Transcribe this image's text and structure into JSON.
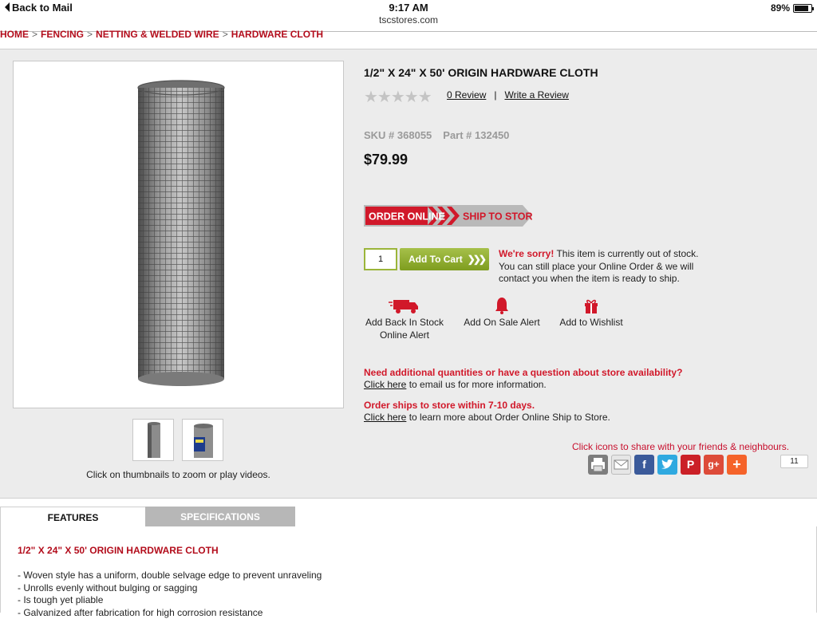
{
  "status_bar": {
    "back_label": "Back to Mail",
    "time": "9:17 AM",
    "battery_percent": "89%",
    "battery_level": 0.89
  },
  "browser": {
    "url": "tscstores.com"
  },
  "breadcrumb": [
    "HOME",
    "FENCING",
    "NETTING & WELDED WIRE",
    "HARDWARE CLOTH"
  ],
  "breadcrumb_separator": ">",
  "product": {
    "title": "1/2\" X 24\" X 50' ORIGIN HARDWARE CLOTH",
    "rating_stars": "★★★★★",
    "rating_value": 0,
    "review_count_label": "0 Review",
    "write_review_label": "Write a Review",
    "review_separator": "|",
    "sku_label": "SKU # 368055",
    "part_label": "Part # 132450",
    "price": "$79.99",
    "badge_left": "ORDER ONLINE",
    "badge_right": "SHIP TO STORE",
    "quantity": "1",
    "add_to_cart_label": "Add To Cart",
    "add_to_cart_arrows": "❯❯❯",
    "stock_sorry": "We're sorry!",
    "stock_message": " This item is currently out of stock. You can still place your Online Order & we will contact you when the item is ready to ship."
  },
  "alerts": [
    {
      "label_line1": "Add Back In Stock",
      "label_line2": "Online Alert",
      "icon": "truck-icon"
    },
    {
      "label_line1": "Add On Sale Alert",
      "label_line2": "",
      "icon": "bell-icon"
    },
    {
      "label_line1": "Add to Wishlist",
      "label_line2": "",
      "icon": "gift-icon"
    }
  ],
  "info": {
    "quantities_heading": "Need additional quantities or have a question about store availability?",
    "quantities_link": "Click here",
    "quantities_text": " to email us for more information.",
    "ship_heading": "Order ships to store within 7-10 days.",
    "ship_link": "Click here",
    "ship_text": " to learn more about Order Online Ship to Store."
  },
  "gallery": {
    "thumb_note": "Click on thumbnails to zoom or play videos."
  },
  "share": {
    "note": "Click icons to share with your friends & neighbours.",
    "count": "11",
    "icons": [
      "print-icon",
      "email-icon",
      "facebook-icon",
      "twitter-icon",
      "pinterest-icon",
      "google-plus-icon",
      "addthis-plus-icon"
    ],
    "colors": {
      "print": "#7d7d7d",
      "email": "#e6e6e6",
      "facebook": "#3b5a9a",
      "twitter": "#2fa9e0",
      "pinterest": "#cb2027",
      "google_plus": "#dd4b39",
      "addthis": "#f5632a"
    }
  },
  "tabs": {
    "features": "FEATURES",
    "specifications": "SPECIFICATIONS"
  },
  "features": {
    "title": "1/2\" X 24\" X 50' ORIGIN HARDWARE CLOTH",
    "bullets": [
      "- Woven style has a uniform, double selvage edge to prevent unraveling",
      "- Unrolls evenly without bulging or sagging",
      "- Is tough yet pliable",
      "- Galvanized after fabrication for high corrosion resistance"
    ]
  },
  "colors": {
    "brand_red": "#b30d1c",
    "alert_red": "#d1182a",
    "cart_green": "#8aa92b",
    "panel_bg": "#ececec"
  }
}
